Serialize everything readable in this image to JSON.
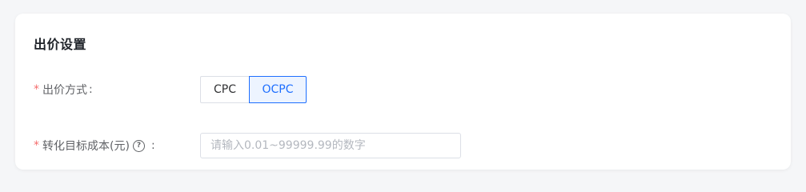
{
  "section": {
    "title": "出价设置"
  },
  "bid_method": {
    "required_mark": "*",
    "label": "出价方式",
    "colon": ":",
    "options": [
      "CPC",
      "OCPC"
    ],
    "selected": "OCPC"
  },
  "target_cost": {
    "required_mark": "*",
    "label": "转化目标成本(元)",
    "help_icon": "help-circle-icon",
    "help_glyph": "?",
    "colon": ":",
    "placeholder": "请输入0.01~99999.99的数字",
    "value": ""
  },
  "colors": {
    "accent": "#1e6fff",
    "required": "#f56c6c"
  }
}
